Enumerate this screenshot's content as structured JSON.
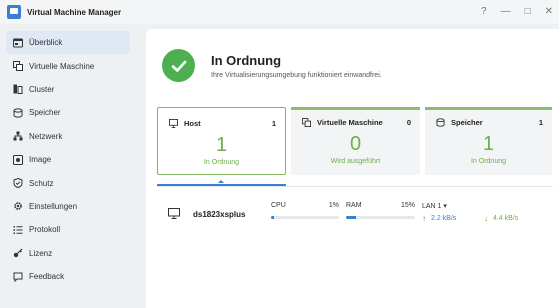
{
  "window": {
    "title": "Virtual Machine Manager",
    "help": "?",
    "minimize": "—",
    "maximize": "□",
    "close": "✕"
  },
  "sidebar": {
    "items": [
      {
        "label": "Überblick",
        "icon": "overview-icon"
      },
      {
        "label": "Virtuelle Maschine",
        "icon": "vm-icon"
      },
      {
        "label": "Cluster",
        "icon": "cluster-icon"
      },
      {
        "label": "Speicher",
        "icon": "storage-icon"
      },
      {
        "label": "Netzwerk",
        "icon": "network-icon"
      },
      {
        "label": "Image",
        "icon": "image-icon"
      },
      {
        "label": "Schutz",
        "icon": "shield-icon"
      },
      {
        "label": "Einstellungen",
        "icon": "gear-icon"
      },
      {
        "label": "Protokoll",
        "icon": "log-icon"
      },
      {
        "label": "Lizenz",
        "icon": "key-icon"
      },
      {
        "label": "Feedback",
        "icon": "feedback-icon"
      }
    ]
  },
  "status": {
    "title": "In Ordnung",
    "subtitle": "Ihre Virtualisierungsumgebung funktioniert einwandfrei."
  },
  "cards": [
    {
      "title": "Host",
      "count": "1",
      "value": "1",
      "status": "In Ordnung"
    },
    {
      "title": "Virtuelle Maschine",
      "count": "0",
      "value": "0",
      "status": "Wird ausgeführt"
    },
    {
      "title": "Speicher",
      "count": "1",
      "value": "1",
      "status": "In Ordnung"
    }
  ],
  "host": {
    "name": "ds1823xsplus",
    "cpu": {
      "label": "CPU",
      "value": "1%",
      "fraction": 0.04
    },
    "ram": {
      "label": "RAM",
      "value": "15%",
      "fraction": 0.15
    },
    "lan": "LAN 1",
    "upload": "2.2 kB/s",
    "download": "4.4 kB/s"
  },
  "colors": {
    "accent": "#3b7fd0",
    "ok": "#6bb04a"
  }
}
